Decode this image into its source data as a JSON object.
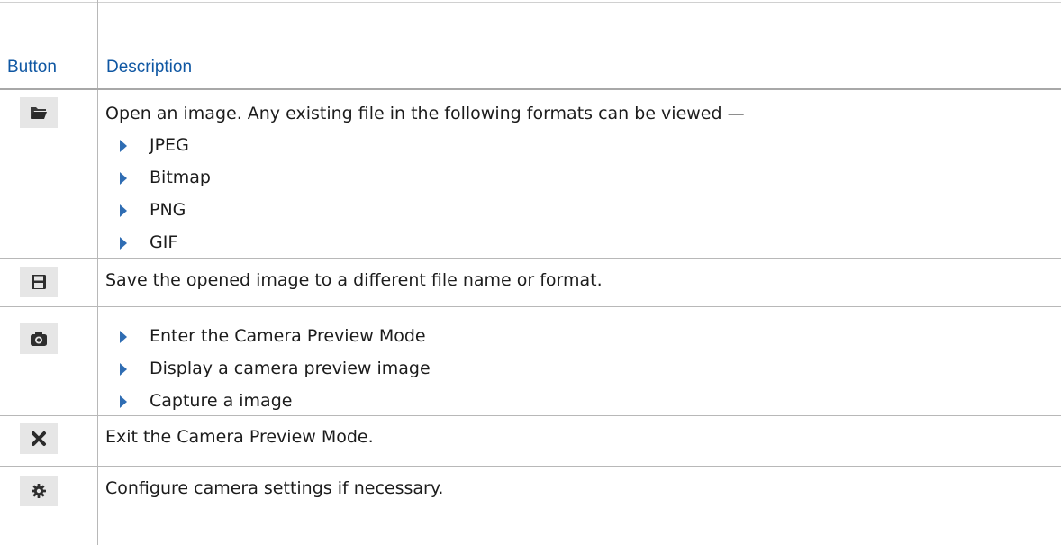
{
  "headers": {
    "button": "Button",
    "description": "Description"
  },
  "rows": [
    {
      "icon": "folder-open-icon",
      "text": "Open an image. Any existing file in the following formats can be viewed —",
      "bullets": [
        "JPEG",
        "Bitmap",
        "PNG",
        "GIF"
      ]
    },
    {
      "icon": "floppy-disk-icon",
      "text": "Save the opened image to a different file name or format.",
      "bullets": []
    },
    {
      "icon": "camera-icon",
      "text": "",
      "bullets": [
        "Enter the Camera Preview Mode",
        "Display a camera preview image",
        "Capture a image"
      ]
    },
    {
      "icon": "close-x-icon",
      "text": "Exit the Camera Preview Mode.",
      "bullets": []
    },
    {
      "icon": "gear-icon",
      "text": "Configure camera settings if necessary.",
      "bullets": []
    }
  ],
  "colors": {
    "header_text": "#0f57a3",
    "bullet": "#2f6db3",
    "icon_bg": "#e6e6e6"
  }
}
